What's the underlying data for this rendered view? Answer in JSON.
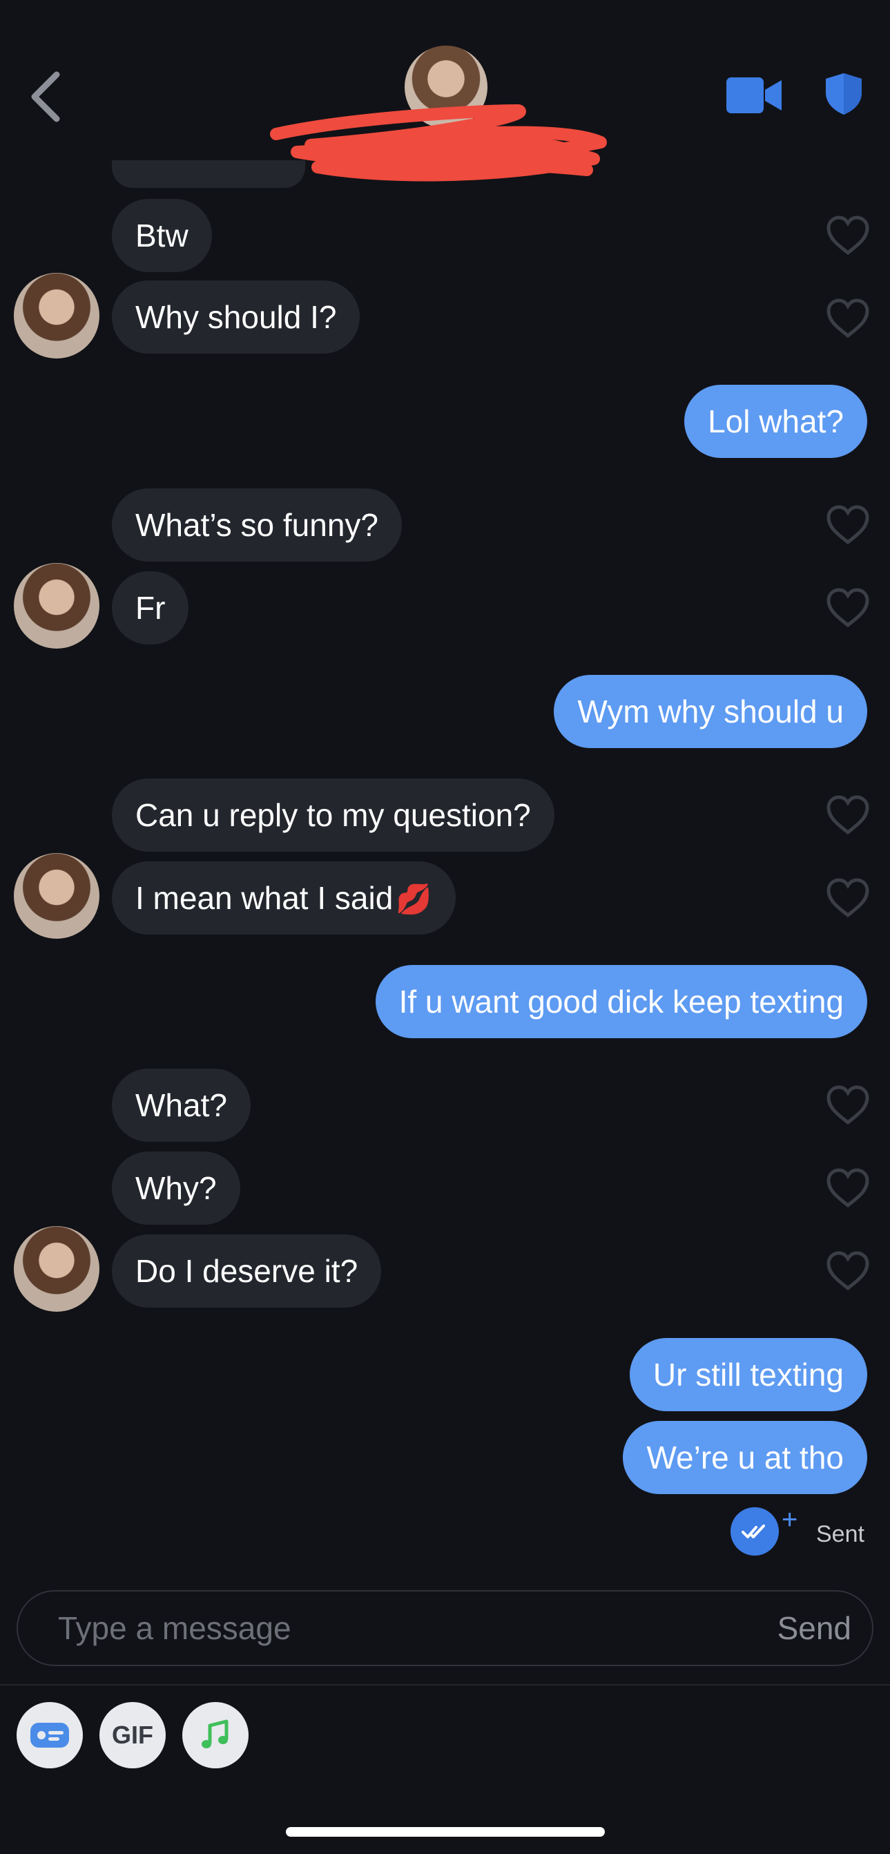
{
  "messages": {
    "m1": "Btw",
    "m2": "Why should I?",
    "m3": "Lol what?",
    "m4": "What’s so funny?",
    "m5": "Fr",
    "m6": "Wym why should u",
    "m7": "Can u reply to my question?",
    "m8": "I mean what I said",
    "m8_emoji": "💋",
    "m9": "If u want good dick keep texting",
    "m10": "What?",
    "m11": "Why?",
    "m12": "Do I deserve it?",
    "m13": "Ur still texting",
    "m14": "We’re u at tho"
  },
  "status": {
    "label": "Sent",
    "plus": "+"
  },
  "composer": {
    "placeholder": "Type a message",
    "send_label": "Send"
  },
  "tools": {
    "gif_label": "GIF"
  },
  "colors": {
    "accent": "#5e9bf2",
    "incoming_bubble": "#23262d",
    "background": "#111217",
    "redaction": "#ef4b3e"
  },
  "icons": [
    "back-chevron-icon",
    "video-call-icon",
    "shield-icon",
    "heart-icon",
    "double-check-icon",
    "card-icon",
    "gif-icon",
    "music-note-icon"
  ]
}
